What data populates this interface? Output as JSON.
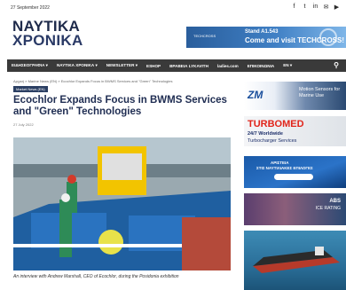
{
  "header": {
    "date": "27 September 2022",
    "social_icons": [
      "facebook-icon",
      "twitter-icon",
      "linkedin-icon",
      "email-icon",
      "youtube-icon"
    ],
    "social_glyphs": [
      "f",
      "t",
      "in",
      "✉",
      "▶"
    ],
    "logo_line1": "ΝΑΥΤΙΚΑ",
    "logo_line2": "ΧΡΟΝΙΚΑ",
    "ad": {
      "brand": "TECHCROSS",
      "line1": "Stand A1.543",
      "line2": "Come and visit TECHCROSS!"
    }
  },
  "nav": {
    "items": [
      "ΕΙΔΗΣΕΟΓΡΑΦΙΑ ▾",
      "ΝΑΥΤΙΚΑ ΧΡΟΝΙΚΑ ▾",
      "NEWSLETTER ▾",
      "ESHOP",
      "ΒΡΑΒΕΙΑ LYKAVITH",
      "ladies.com",
      "ΕΠΙΚΟΙΝΩΝΙΑ",
      "EN ▾"
    ],
    "search_icon": "search-icon"
  },
  "article": {
    "breadcrumb": "Αρχική » Marine News (EN) » Ecochlor Expands Focus in BWMS Services and \"Green\" Technologies",
    "category": "Market News (EN)",
    "title": "Ecochlor Expands Focus in BWMS Services and \"Green\" Technologies",
    "date": "27 July 2022",
    "caption": "An interview with Andrew Marshall, CEO of Ecochlor, during the Posidonia exhibition"
  },
  "sidebar": {
    "ad1": {
      "logo": "ZM",
      "text": "Motion Sensors for Marine Use"
    },
    "ad2": {
      "logo": "TURBOMED",
      "line1": "24/7 Worldwide",
      "line2": "Turbocharger Services"
    },
    "ad3": {
      "line1": "ΑΡΙΣΤΕΙΑ",
      "line2": "ΣΤΙΣ ΝΑΥΤΙΛΙΑΚΕΣ ΕΠΙΛΟΓΕΣ",
      "button": ""
    },
    "ad4": {
      "logo": "ABS",
      "line1": "ICE RATING"
    }
  },
  "colors": {
    "nav_bg": "#3a3a3a",
    "title": "#1f2d52",
    "badge_bg": "#2b3f63",
    "turbo_red": "#e1251b"
  }
}
